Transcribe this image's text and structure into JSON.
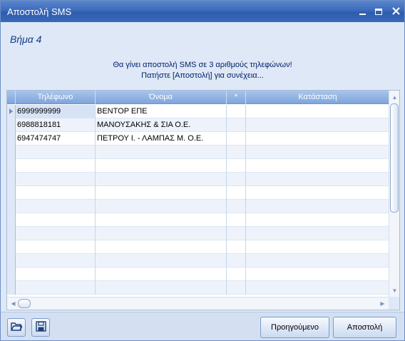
{
  "window": {
    "title": "Αποστολή SMS",
    "controls": {
      "minimize": "minimize-icon",
      "maximize": "maximize-icon",
      "close": "close-icon"
    }
  },
  "step": {
    "label": "Βήμα 4"
  },
  "message": {
    "line1": "Θα γίνει αποστολή SMS σε 3 αριθμούς τηλεφώνων!",
    "line2": "Πατήστε [Αποστολή] για συνέχεια..."
  },
  "grid": {
    "columns": {
      "phone": "Τηλέφωνο",
      "name": "Όνομα",
      "flag": "*",
      "status": "Κατάσταση"
    },
    "rows": [
      {
        "phone": "6999999999",
        "name": "ΒΕΝΤΟΡ ΕΠΕ",
        "flag": "",
        "status": ""
      },
      {
        "phone": "6988818181",
        "name": "ΜΑΝΟΥΣΑΚΗΣ & ΣΙΑ Ο.Ε.",
        "flag": "",
        "status": ""
      },
      {
        "phone": "6947474747",
        "name": "ΠΕΤΡΟΥ Ι. - ΛΑΜΠΑΣ Μ. Ο.Ε.",
        "flag": "",
        "status": ""
      }
    ],
    "selected_row": 0
  },
  "toolbar": {
    "open_icon": "folder-open-icon",
    "save_icon": "floppy-disk-icon",
    "prev_label": "Προηγούμενο",
    "send_label": "Αποστολή"
  },
  "colors": {
    "title_bar": "#3d6bbb",
    "header": "#7fa5dc",
    "step_text": "#123a8c",
    "message_text": "#00216b"
  }
}
